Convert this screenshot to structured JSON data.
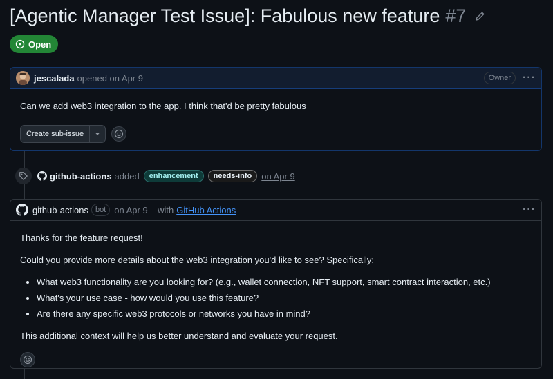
{
  "issue": {
    "title": "[Agentic Manager Test Issue]: Fabulous new feature",
    "number": "#7",
    "state_label": "Open"
  },
  "first_comment": {
    "author": "jescalada",
    "meta": "opened on Apr 9",
    "role": "Owner",
    "body": "Can we add web3 integration to the app. I think that'd be pretty fabulous",
    "create_sub_issue_label": "Create sub-issue"
  },
  "label_event": {
    "actor": "github-actions",
    "action": "added",
    "labels": [
      "enhancement",
      "needs-info"
    ],
    "date": "on Apr 9"
  },
  "bot_comment": {
    "author": "github-actions",
    "badge": "bot",
    "meta": "on Apr 9 – with",
    "app_link": "GitHub Actions",
    "para1": "Thanks for the feature request!",
    "para2": "Could you provide more details about the web3 integration you'd like to see? Specifically:",
    "bullets": [
      "What web3 functionality are you looking for? (e.g., wallet connection, NFT support, smart contract interaction, etc.)",
      "What's your use case - how would you use this feature?",
      "Are there any specific web3 protocols or networks you have in mind?"
    ],
    "para3": "This additional context will help us better understand and evaluate your request."
  },
  "icons": {
    "edit": "pencil-icon",
    "state": "issue-open-icon",
    "menu": "kebab-horizontal-icon",
    "emoji": "smiley-icon",
    "label": "tag-icon",
    "github": "github-mark-icon",
    "dropdown": "triangle-down-icon"
  },
  "colors": {
    "background": "#0d1117",
    "open_green": "#238636",
    "link_blue": "#4493f8",
    "label_enhancement_bg": "#0e3b39",
    "label_enhancement_fg": "#a2eeef"
  }
}
